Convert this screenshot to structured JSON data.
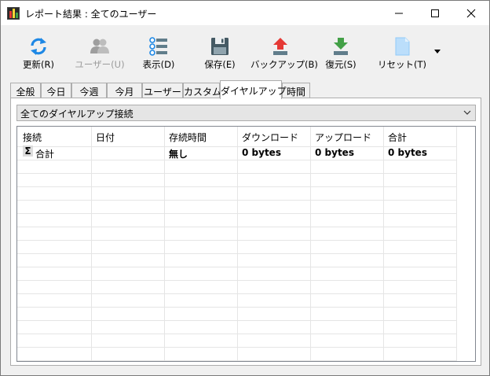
{
  "window": {
    "title": "レポート結果 : 全てのユーザー"
  },
  "toolbar": {
    "buttons": [
      {
        "label": "更新(R)",
        "icon": "refresh-icon",
        "color": "#1e88e5",
        "enabled": true
      },
      {
        "label": "ユーザー(U)",
        "icon": "users-icon",
        "color": "#9e9e9e",
        "enabled": false
      },
      {
        "label": "表示(D)",
        "icon": "list-view-icon",
        "color": "#1e88e5",
        "enabled": true
      },
      {
        "label": "保存(E)",
        "icon": "save-icon",
        "color": "#455a64",
        "enabled": true
      },
      {
        "label": "バックアップ(B)",
        "icon": "backup-icon",
        "color": "#e53935",
        "enabled": true
      },
      {
        "label": "復元(S)",
        "icon": "restore-icon",
        "color": "#43a047",
        "enabled": true
      },
      {
        "label": "リセット(T)",
        "icon": "reset-icon",
        "color": "#90caf9",
        "enabled": true
      }
    ]
  },
  "tabs": [
    {
      "label": "全般",
      "active": false
    },
    {
      "label": "今日",
      "active": false
    },
    {
      "label": "今週",
      "active": false
    },
    {
      "label": "今月",
      "active": false
    },
    {
      "label": "ユーザー",
      "active": false
    },
    {
      "label": "カスタム",
      "active": false
    },
    {
      "label": "ダイヤルアップ",
      "active": true
    },
    {
      "label": "時間",
      "active": false
    }
  ],
  "filter": {
    "selected": "全てのダイヤルアップ接続"
  },
  "table": {
    "columns": [
      "接続",
      "日付",
      "存続時間",
      "ダウンロード",
      "アップロード",
      "合計"
    ],
    "rows": [
      [
        "合計",
        "",
        "無し",
        "0 bytes",
        "0 bytes",
        "0 bytes"
      ]
    ]
  }
}
